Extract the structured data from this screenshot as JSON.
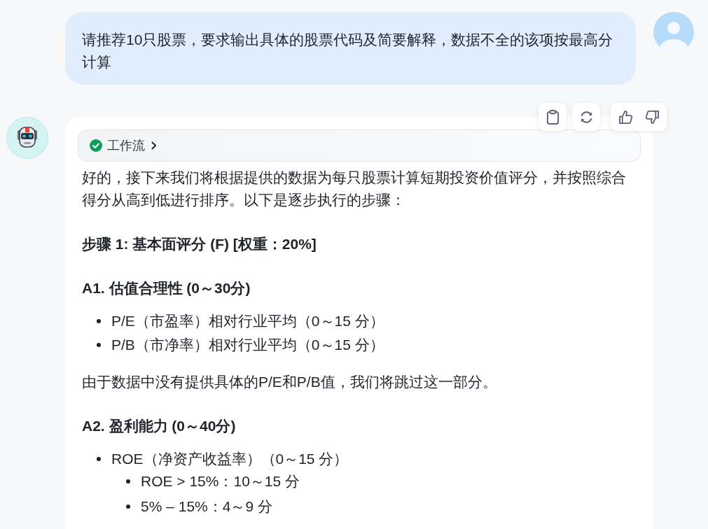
{
  "user_message": {
    "text": "请推荐10只股票，要求输出具体的股票代码及简要解释，数据不全的该项按最高分计算"
  },
  "assistant_message": {
    "workflow": {
      "label": "工作流",
      "completed": true,
      "expanded": false
    },
    "content": [
      {
        "kind": "paragraph",
        "text": "好的，接下来我们将根据提供的数据为每只股票计算短期投资价值评分，并按照综合得分从高到低进行排序。以下是逐步执行的步骤："
      },
      {
        "kind": "heading",
        "text": "步骤 1: 基本面评分 (F) [权重：20%]"
      },
      {
        "kind": "heading",
        "text": "A1. 估值合理性 (0～30分)"
      },
      {
        "kind": "list",
        "items": [
          {
            "text": "P/E（市盈率）相对行业平均（0～15 分）"
          },
          {
            "text": "P/B（市净率）相对行业平均（0～15 分）"
          }
        ]
      },
      {
        "kind": "paragraph",
        "text": "由于数据中没有提供具体的P/E和P/B值，我们将跳过这一部分。"
      },
      {
        "kind": "heading",
        "text": "A2. 盈利能力 (0～40分)"
      },
      {
        "kind": "list",
        "items": [
          {
            "text": "ROE（净资产收益率）（0～15 分）",
            "children": [
              {
                "text": "ROE > 15%：10～15 分"
              },
              {
                "text": "5% – 15%：4～9 分"
              }
            ]
          }
        ]
      }
    ]
  }
}
